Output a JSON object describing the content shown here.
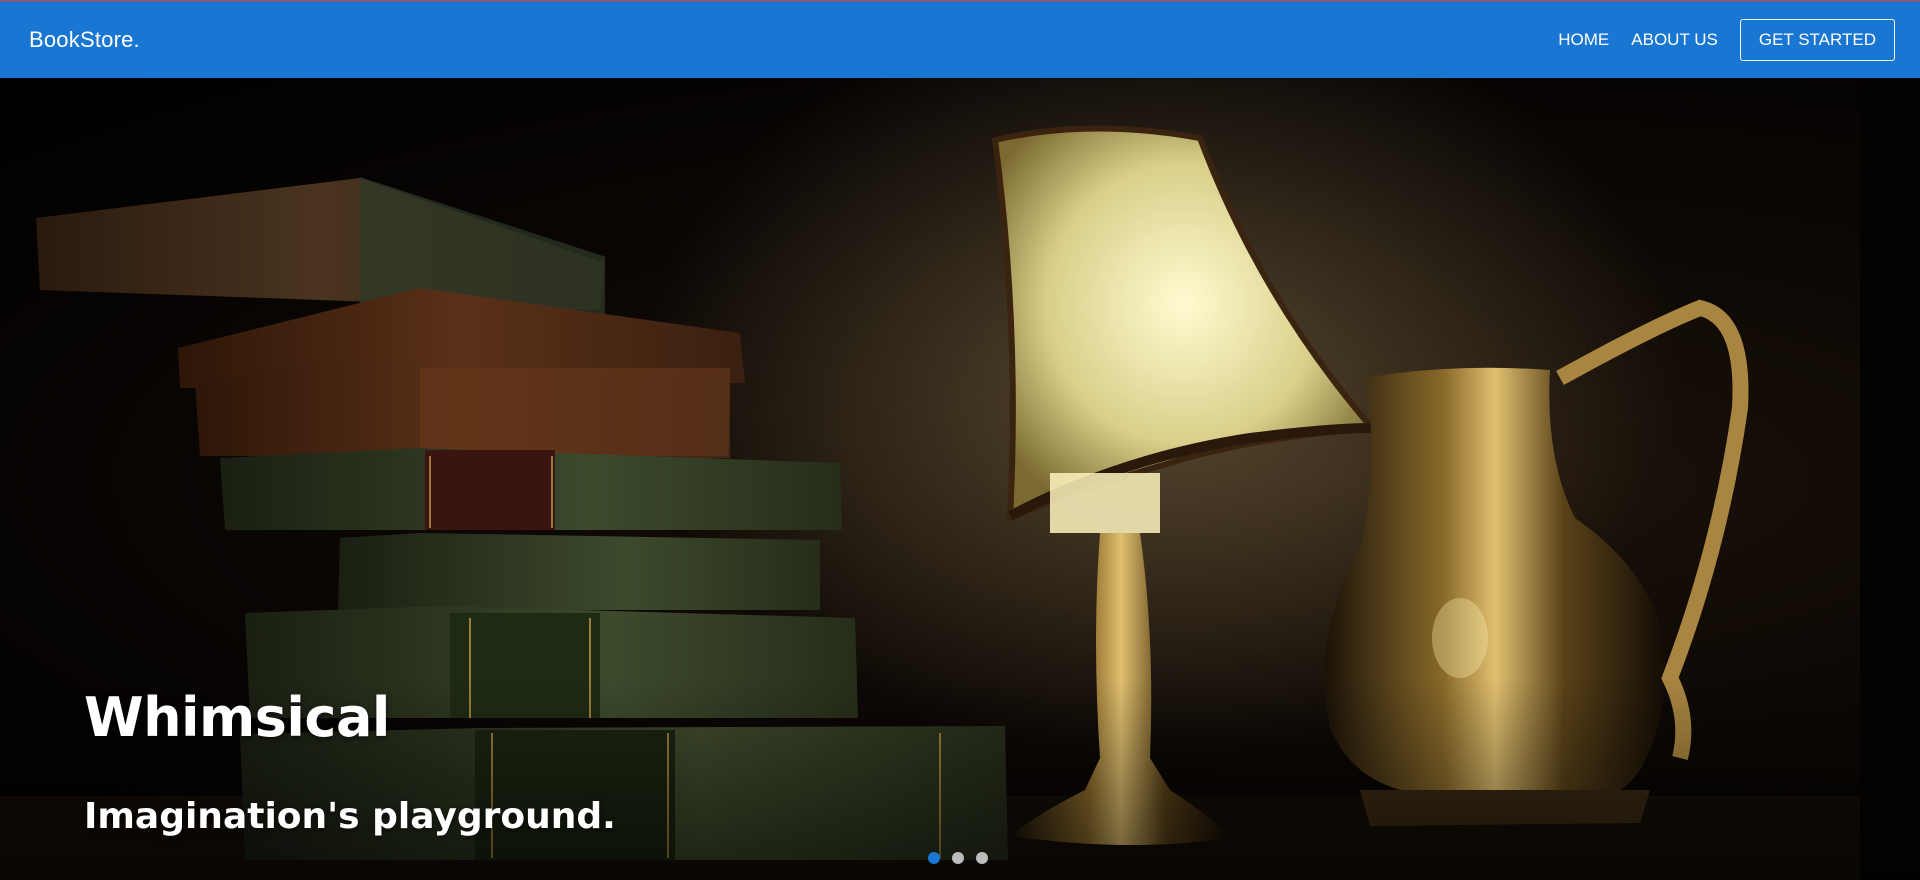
{
  "navbar": {
    "brand": "BookStore.",
    "links": [
      {
        "label": "HOME"
      },
      {
        "label": "ABOUT US"
      }
    ],
    "cta_label": "GET STARTED",
    "color": "#1976d2"
  },
  "hero": {
    "title": "Whimsical",
    "subtitle": "Imagination's playground.",
    "carousel": {
      "slides": 3,
      "active_index": 0,
      "active_color": "#1976d2",
      "inactive_color": "#bdbdbd"
    }
  }
}
